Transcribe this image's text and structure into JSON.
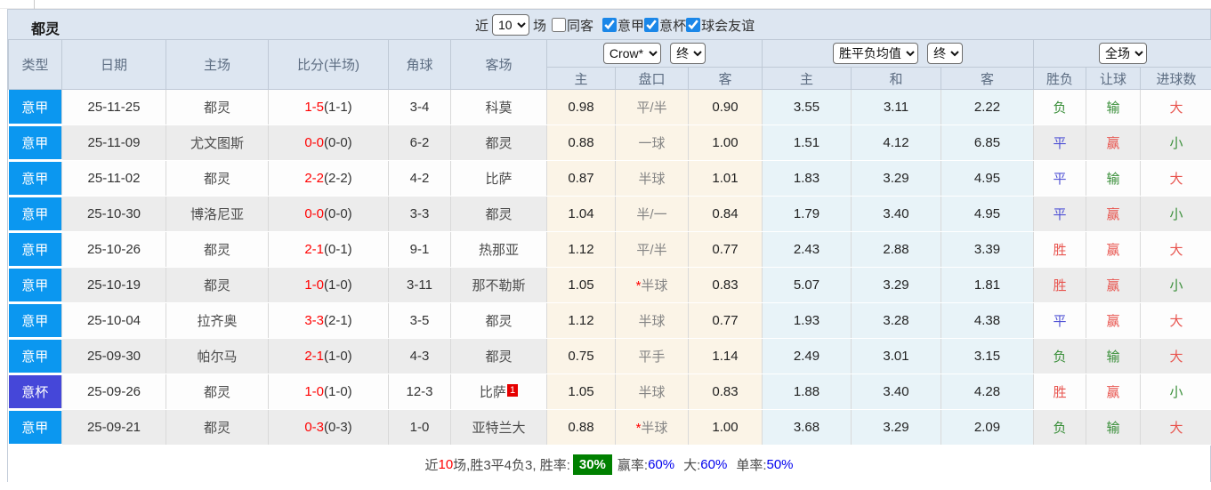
{
  "colors": {
    "serie_a_badge": "#0b97f0",
    "coppa_badge": "#4547d9",
    "win_red": "#e8554f",
    "draw_blue": "#5153d5",
    "lose_green": "#3a8f3a",
    "score_red": "#ff0000",
    "rate_badge_bg": "#008000",
    "percent_blue": "#0000ee",
    "header_bg": "#dde6f1"
  },
  "toolbar": {
    "team_title": "都灵",
    "recent_label": "近",
    "recent_value": "10",
    "matches_label": "场",
    "same_away_label": "同客",
    "same_away_checked": false,
    "leagues": [
      {
        "label": "意甲",
        "checked": true
      },
      {
        "label": "意杯",
        "checked": true
      },
      {
        "label": "球会友谊",
        "checked": true
      }
    ]
  },
  "header": {
    "col_type": "类型",
    "col_date": "日期",
    "col_home": "主场",
    "col_score": "比分(半场)",
    "col_corner": "角球",
    "col_away": "客场",
    "sel_company": "Crow*",
    "sel_final1": "终",
    "sel_avg": "胜平负均值",
    "sel_final2": "终",
    "sel_scope": "全场",
    "sub": [
      "主",
      "盘口",
      "客",
      "主",
      "和",
      "客",
      "胜负",
      "让球",
      "进球数"
    ]
  },
  "rows": [
    {
      "league": "意甲",
      "lcls": "t-lega",
      "date": "25-11-25",
      "home": "都灵",
      "home_c": "tg",
      "score": "1-5",
      "half": "(1-1)",
      "corners": "3-4",
      "away": "科莫",
      "away_c": "",
      "badge": "",
      "star": "",
      "o1": "0.98",
      "pk": "平/半",
      "o2": "0.90",
      "a1": "3.55",
      "a2": "3.11",
      "a3": "2.22",
      "res": "负",
      "res_c": "g",
      "let": "输",
      "let_c": "g",
      "goal": "大",
      "goal_c": "r"
    },
    {
      "league": "意甲",
      "lcls": "t-lega",
      "date": "25-11-09",
      "home": "尤文图斯",
      "home_c": "",
      "score": "0-0",
      "half": "(0-0)",
      "corners": "6-2",
      "away": "都灵",
      "away_c": "tg",
      "badge": "",
      "star": "",
      "o1": "0.88",
      "pk": "一球",
      "o2": "1.00",
      "a1": "1.51",
      "a2": "4.12",
      "a3": "6.85",
      "res": "平",
      "res_c": "b",
      "let": "赢",
      "let_c": "r",
      "goal": "小",
      "goal_c": "g"
    },
    {
      "league": "意甲",
      "lcls": "t-lega",
      "date": "25-11-02",
      "home": "都灵",
      "home_c": "tg",
      "score": "2-2",
      "half": "(2-2)",
      "corners": "4-2",
      "away": "比萨",
      "away_c": "",
      "badge": "",
      "star": "",
      "o1": "0.87",
      "pk": "半球",
      "o2": "1.01",
      "a1": "1.83",
      "a2": "3.29",
      "a3": "4.95",
      "res": "平",
      "res_c": "b",
      "let": "输",
      "let_c": "g",
      "goal": "大",
      "goal_c": "r"
    },
    {
      "league": "意甲",
      "lcls": "t-lega",
      "date": "25-10-30",
      "home": "博洛尼亚",
      "home_c": "",
      "score": "0-0",
      "half": "(0-0)",
      "corners": "3-3",
      "away": "都灵",
      "away_c": "tg",
      "badge": "",
      "star": "",
      "o1": "1.04",
      "pk": "半/一",
      "o2": "0.84",
      "a1": "1.79",
      "a2": "3.40",
      "a3": "4.95",
      "res": "平",
      "res_c": "b",
      "let": "赢",
      "let_c": "r",
      "goal": "小",
      "goal_c": "g"
    },
    {
      "league": "意甲",
      "lcls": "t-lega",
      "date": "25-10-26",
      "home": "都灵",
      "home_c": "tg",
      "score": "2-1",
      "half": "(0-1)",
      "corners": "9-1",
      "away": "热那亚",
      "away_c": "",
      "badge": "",
      "star": "",
      "o1": "1.12",
      "pk": "平/半",
      "o2": "0.77",
      "a1": "2.43",
      "a2": "2.88",
      "a3": "3.39",
      "res": "胜",
      "res_c": "r",
      "let": "赢",
      "let_c": "r",
      "goal": "大",
      "goal_c": "r"
    },
    {
      "league": "意甲",
      "lcls": "t-lega",
      "date": "25-10-19",
      "home": "都灵",
      "home_c": "tg",
      "score": "1-0",
      "half": "(1-0)",
      "corners": "3-11",
      "away": "那不勒斯",
      "away_c": "",
      "badge": "",
      "star": "*",
      "o1": "1.05",
      "pk": "半球",
      "o2": "0.83",
      "a1": "5.07",
      "a2": "3.29",
      "a3": "1.81",
      "res": "胜",
      "res_c": "r",
      "let": "赢",
      "let_c": "r",
      "goal": "小",
      "goal_c": "g"
    },
    {
      "league": "意甲",
      "lcls": "t-lega",
      "date": "25-10-04",
      "home": "拉齐奥",
      "home_c": "",
      "score": "3-3",
      "half": "(2-1)",
      "corners": "3-5",
      "away": "都灵",
      "away_c": "tg",
      "badge": "",
      "star": "",
      "o1": "1.12",
      "pk": "半球",
      "o2": "0.77",
      "a1": "1.93",
      "a2": "3.28",
      "a3": "4.38",
      "res": "平",
      "res_c": "b",
      "let": "赢",
      "let_c": "r",
      "goal": "大",
      "goal_c": "r"
    },
    {
      "league": "意甲",
      "lcls": "t-lega",
      "date": "25-09-30",
      "home": "帕尔马",
      "home_c": "",
      "score": "2-1",
      "half": "(1-0)",
      "corners": "4-3",
      "away": "都灵",
      "away_c": "tg",
      "badge": "",
      "star": "",
      "o1": "0.75",
      "pk": "平手",
      "o2": "1.14",
      "a1": "2.49",
      "a2": "3.01",
      "a3": "3.15",
      "res": "负",
      "res_c": "g",
      "let": "输",
      "let_c": "g",
      "goal": "大",
      "goal_c": "r"
    },
    {
      "league": "意杯",
      "lcls": "t-cup",
      "date": "25-09-26",
      "home": "都灵",
      "home_c": "tg",
      "score": "1-0",
      "half": "(1-0)",
      "corners": "12-3",
      "away": "比萨",
      "away_c": "",
      "badge": "1",
      "star": "",
      "o1": "1.05",
      "pk": "半球",
      "o2": "0.83",
      "a1": "1.88",
      "a2": "3.40",
      "a3": "4.28",
      "res": "胜",
      "res_c": "r",
      "let": "赢",
      "let_c": "r",
      "goal": "小",
      "goal_c": "g"
    },
    {
      "league": "意甲",
      "lcls": "t-lega",
      "date": "25-09-21",
      "home": "都灵",
      "home_c": "tg",
      "score": "0-3",
      "half": "(0-3)",
      "corners": "1-0",
      "away": "亚特兰大",
      "away_c": "",
      "badge": "",
      "star": "*",
      "o1": "0.88",
      "pk": "半球",
      "o2": "1.00",
      "a1": "3.68",
      "a2": "3.29",
      "a3": "2.09",
      "res": "负",
      "res_c": "g",
      "let": "输",
      "let_c": "g",
      "goal": "大",
      "goal_c": "r"
    }
  ],
  "footer": {
    "p1": "近",
    "p2": "10",
    "p3": "场,胜3平4负3, 胜率:",
    "rate": "30%",
    "p4": "赢率:",
    "v4": "60%",
    "p5": "大:",
    "v5": "60%",
    "p6": "单率:",
    "v6": "50%"
  }
}
